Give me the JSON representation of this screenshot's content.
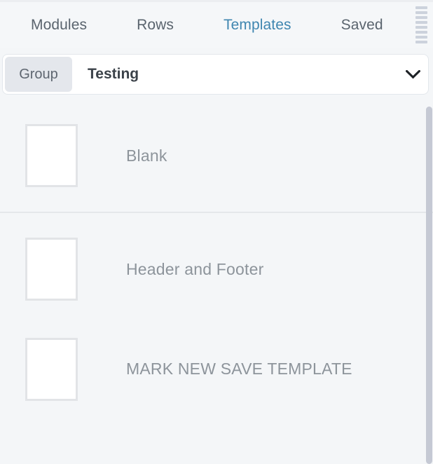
{
  "theme": {
    "background": "#f4f6f8",
    "accent": "#3f86b0",
    "tab_inactive": "#5a646e",
    "label_muted": "#8d949b",
    "panel_white": "#ffffff",
    "pill_gray": "#e4e7ec",
    "divider": "#e5e8eb",
    "scrollbar_thumb": "#c5c9d4",
    "thumb_border": "#e2e4e7"
  },
  "tabbar": {
    "drag_handle_icon": "grip-handle-icon",
    "drag_handle_bars": 8,
    "tabs": [
      {
        "label": "Modules",
        "active": false
      },
      {
        "label": "Rows",
        "active": false
      },
      {
        "label": "Templates",
        "active": true
      },
      {
        "label": "Saved",
        "active": false
      }
    ]
  },
  "groupbar": {
    "pill_label": "Group",
    "selected_value": "Testing",
    "chevron_icon": "chevron-down-icon"
  },
  "list": {
    "sections": [
      {
        "items": [
          {
            "label": "Blank",
            "thumbnail": "blank-template-thumbnail"
          }
        ]
      },
      {
        "items": [
          {
            "label": "Header and Footer",
            "thumbnail": "blank-template-thumbnail"
          },
          {
            "label": "MARK NEW SAVE TEMPLATE",
            "thumbnail": "blank-template-thumbnail"
          }
        ]
      }
    ]
  },
  "scrollbar": {
    "orientation": "vertical",
    "thumb_name": "vertical-scrollbar-thumb"
  }
}
